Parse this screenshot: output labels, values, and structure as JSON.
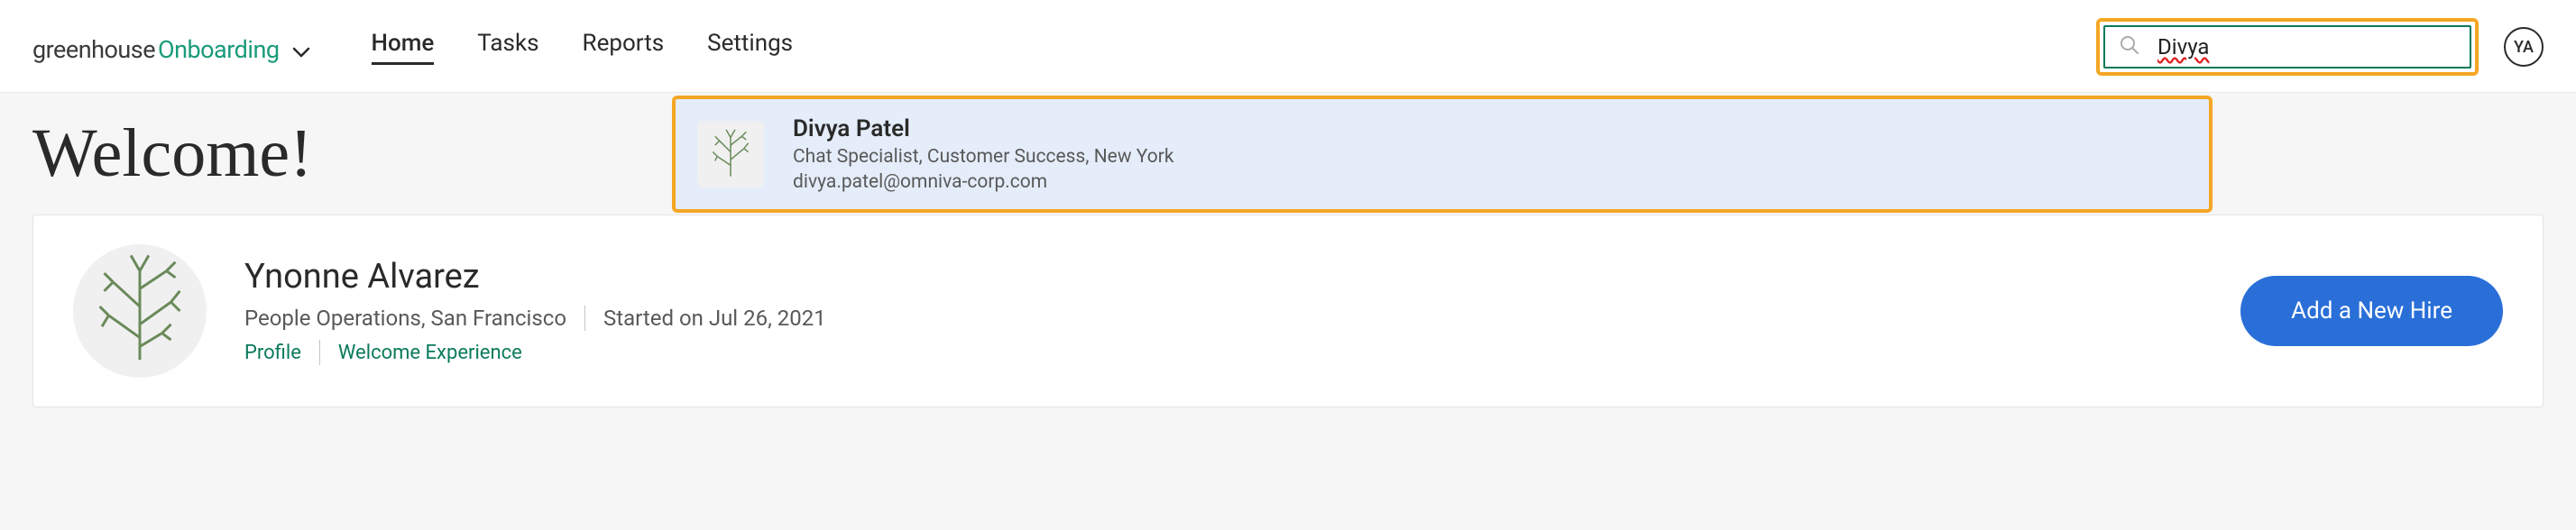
{
  "header": {
    "logo_first": "greenhouse",
    "logo_second": "Onboarding",
    "nav": [
      "Home",
      "Tasks",
      "Reports",
      "Settings"
    ],
    "active_nav_index": 0,
    "search_value": "Divya",
    "avatar_initials": "YA"
  },
  "search_result": {
    "name": "Divya Patel",
    "role": "Chat Specialist, Customer Success, New York",
    "email": "divya.patel@omniva-corp.com"
  },
  "welcome": {
    "title": "Welcome!"
  },
  "user": {
    "name": "Ynonne Alvarez",
    "dept": "People Operations, San Francisco",
    "started": "Started on Jul 26, 2021",
    "links": [
      "Profile",
      "Welcome Experience"
    ]
  },
  "actions": {
    "add_new_hire": "Add a New Hire"
  }
}
